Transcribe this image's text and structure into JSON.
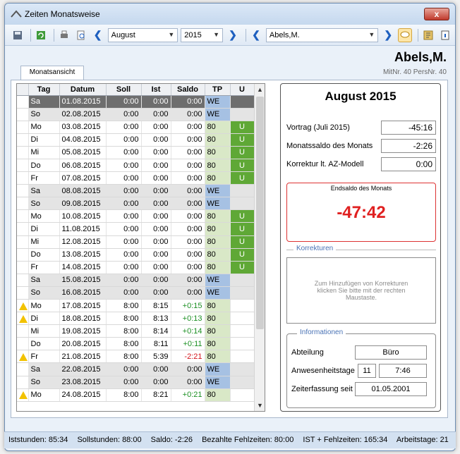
{
  "window": {
    "title": "Zeiten Monatsweise",
    "close_label": "x"
  },
  "toolbar": {
    "month": "August",
    "year": "2015",
    "employee": "Abels,M."
  },
  "header": {
    "employee_name": "Abels,M.",
    "employee_numbers": "MitNr. 40  PersNr. 40"
  },
  "tabs": [
    {
      "label": "Monatsansicht"
    }
  ],
  "grid": {
    "columns": [
      "Tag",
      "Datum",
      "Soll",
      "Ist",
      "Saldo",
      "TP",
      "U"
    ],
    "rows": [
      {
        "warn": false,
        "tag": "Sa",
        "datum": "01.08.2015",
        "soll": "0:00",
        "ist": "0:00",
        "saldo": "0:00",
        "tp": "WE",
        "u": "",
        "weekend": true,
        "selected": true
      },
      {
        "warn": false,
        "tag": "So",
        "datum": "02.08.2015",
        "soll": "0:00",
        "ist": "0:00",
        "saldo": "0:00",
        "tp": "WE",
        "u": "",
        "weekend": true
      },
      {
        "warn": false,
        "tag": "Mo",
        "datum": "03.08.2015",
        "soll": "0:00",
        "ist": "0:00",
        "saldo": "0:00",
        "tp": "80",
        "u": "U"
      },
      {
        "warn": false,
        "tag": "Di",
        "datum": "04.08.2015",
        "soll": "0:00",
        "ist": "0:00",
        "saldo": "0:00",
        "tp": "80",
        "u": "U"
      },
      {
        "warn": false,
        "tag": "Mi",
        "datum": "05.08.2015",
        "soll": "0:00",
        "ist": "0:00",
        "saldo": "0:00",
        "tp": "80",
        "u": "U"
      },
      {
        "warn": false,
        "tag": "Do",
        "datum": "06.08.2015",
        "soll": "0:00",
        "ist": "0:00",
        "saldo": "0:00",
        "tp": "80",
        "u": "U"
      },
      {
        "warn": false,
        "tag": "Fr",
        "datum": "07.08.2015",
        "soll": "0:00",
        "ist": "0:00",
        "saldo": "0:00",
        "tp": "80",
        "u": "U"
      },
      {
        "warn": false,
        "tag": "Sa",
        "datum": "08.08.2015",
        "soll": "0:00",
        "ist": "0:00",
        "saldo": "0:00",
        "tp": "WE",
        "u": "",
        "weekend": true
      },
      {
        "warn": false,
        "tag": "So",
        "datum": "09.08.2015",
        "soll": "0:00",
        "ist": "0:00",
        "saldo": "0:00",
        "tp": "WE",
        "u": "",
        "weekend": true
      },
      {
        "warn": false,
        "tag": "Mo",
        "datum": "10.08.2015",
        "soll": "0:00",
        "ist": "0:00",
        "saldo": "0:00",
        "tp": "80",
        "u": "U"
      },
      {
        "warn": false,
        "tag": "Di",
        "datum": "11.08.2015",
        "soll": "0:00",
        "ist": "0:00",
        "saldo": "0:00",
        "tp": "80",
        "u": "U"
      },
      {
        "warn": false,
        "tag": "Mi",
        "datum": "12.08.2015",
        "soll": "0:00",
        "ist": "0:00",
        "saldo": "0:00",
        "tp": "80",
        "u": "U"
      },
      {
        "warn": false,
        "tag": "Do",
        "datum": "13.08.2015",
        "soll": "0:00",
        "ist": "0:00",
        "saldo": "0:00",
        "tp": "80",
        "u": "U"
      },
      {
        "warn": false,
        "tag": "Fr",
        "datum": "14.08.2015",
        "soll": "0:00",
        "ist": "0:00",
        "saldo": "0:00",
        "tp": "80",
        "u": "U"
      },
      {
        "warn": false,
        "tag": "Sa",
        "datum": "15.08.2015",
        "soll": "0:00",
        "ist": "0:00",
        "saldo": "0:00",
        "tp": "WE",
        "u": "",
        "weekend": true
      },
      {
        "warn": false,
        "tag": "So",
        "datum": "16.08.2015",
        "soll": "0:00",
        "ist": "0:00",
        "saldo": "0:00",
        "tp": "WE",
        "u": "",
        "weekend": true
      },
      {
        "warn": true,
        "tag": "Mo",
        "datum": "17.08.2015",
        "soll": "8:00",
        "ist": "8:15",
        "saldo": "+0:15",
        "tp": "80",
        "u": ""
      },
      {
        "warn": true,
        "tag": "Di",
        "datum": "18.08.2015",
        "soll": "8:00",
        "ist": "8:13",
        "saldo": "+0:13",
        "tp": "80",
        "u": ""
      },
      {
        "warn": false,
        "tag": "Mi",
        "datum": "19.08.2015",
        "soll": "8:00",
        "ist": "8:14",
        "saldo": "+0:14",
        "tp": "80",
        "u": ""
      },
      {
        "warn": false,
        "tag": "Do",
        "datum": "20.08.2015",
        "soll": "8:00",
        "ist": "8:11",
        "saldo": "+0:11",
        "tp": "80",
        "u": ""
      },
      {
        "warn": true,
        "tag": "Fr",
        "datum": "21.08.2015",
        "soll": "8:00",
        "ist": "5:39",
        "saldo": "-2:21",
        "tp": "80",
        "u": ""
      },
      {
        "warn": false,
        "tag": "Sa",
        "datum": "22.08.2015",
        "soll": "0:00",
        "ist": "0:00",
        "saldo": "0:00",
        "tp": "WE",
        "u": "",
        "weekend": true
      },
      {
        "warn": false,
        "tag": "So",
        "datum": "23.08.2015",
        "soll": "0:00",
        "ist": "0:00",
        "saldo": "0:00",
        "tp": "WE",
        "u": "",
        "weekend": true
      },
      {
        "warn": true,
        "tag": "Mo",
        "datum": "24.08.2015",
        "soll": "8:00",
        "ist": "8:21",
        "saldo": "+0:21",
        "tp": "80",
        "u": ""
      }
    ]
  },
  "summary": {
    "month_title": "August 2015",
    "vortrag_label": "Vortrag (Juli 2015)",
    "vortrag_value": "-45:16",
    "monatssaldo_label": "Monatssaldo des Monats",
    "monatssaldo_value": "-2:26",
    "korrektur_label": "Korrektur lt. AZ-Modell",
    "korrektur_value": "0:00",
    "endsaldo_label": "Endsaldo des Monats",
    "endsaldo_value": "-47:42"
  },
  "korrekturen": {
    "title": "Korrekturen",
    "hint": "Zum Hinzufügen von Korrekturen klicken Sie bitte mit der rechten Maustaste."
  },
  "informationen": {
    "title": "Informationen",
    "abteilung_label": "Abteilung",
    "abteilung_value": "Büro",
    "anwesenheit_label": "Anwesenheitstage",
    "anwesenheit_days": "11",
    "anwesenheit_avg": "7:46",
    "zeiterfassung_label": "Zeiterfassung seit",
    "zeiterfassung_value": "01.05.2001"
  },
  "statusbar": {
    "iststunden": "Iststunden: 85:34",
    "sollstunden": "Sollstunden: 88:00",
    "saldo": "Saldo: -2:26",
    "fehlzeiten": "Bezahlte Fehlzeiten: 80:00",
    "ist_fehl": "IST + Fehlzeiten: 165:34",
    "arbeitstage": "Arbeitstage: 21"
  },
  "colors": {
    "weekend_tp": "#a6c1e3",
    "workday_tp": "#d9e8c7",
    "urlaub": "#5fa836",
    "positive": "#1b8f22",
    "negative": "#d3131a"
  }
}
